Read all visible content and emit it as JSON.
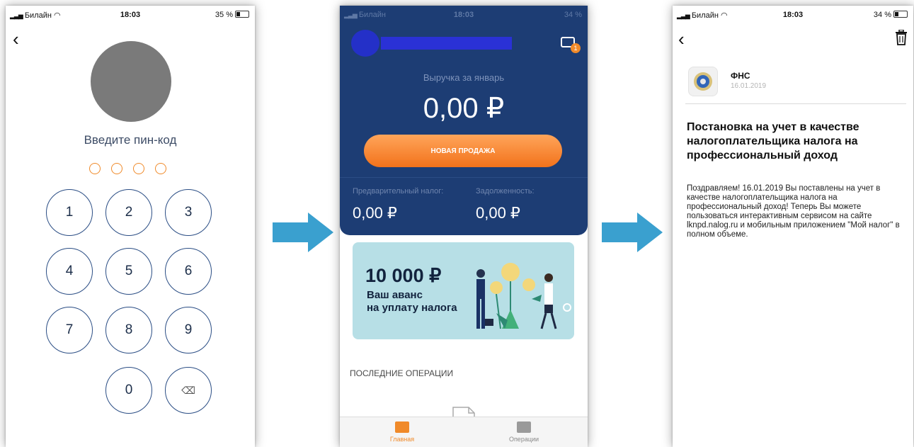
{
  "status_left": {
    "carrier": "Билайн",
    "time": "18:03",
    "battery": "35 %"
  },
  "status_mid": {
    "carrier": "Билайн",
    "time": "18:03",
    "battery": "34 %"
  },
  "status_right": {
    "carrier": "Билайн",
    "time": "18:03",
    "battery": "34 %"
  },
  "pin_screen": {
    "title": "Введите пин-код",
    "keys": [
      "1",
      "2",
      "3",
      "4",
      "5",
      "6",
      "7",
      "8",
      "9",
      "0"
    ],
    "delete_glyph": "⌫"
  },
  "dashboard": {
    "mail_badge": "1",
    "revenue_label": "Выручка за январь",
    "revenue_value": "0,00 ₽",
    "new_sale_label": "НОВАЯ ПРОДАЖА",
    "tax_label": "Предварительный налог:",
    "tax_value": "0,00 ₽",
    "debt_label": "Задолженность:",
    "debt_value": "0,00 ₽",
    "promo": {
      "amount": "10 000 ₽",
      "line1": "Ваш аванс",
      "line2": "на уплату налога"
    },
    "recent_title": "ПОСЛЕДНИЕ ОПЕРАЦИИ",
    "tabs": [
      "Главная",
      "Операции"
    ]
  },
  "message": {
    "sender": "ФНС",
    "date": "16.01.2019",
    "title": "Постановка на учет в качестве налогоплательщика налога на профессиональный доход",
    "body": "Поздравляем! 16.01.2019 Вы поставлены на учет в качестве налогоплательщика налога на профессиональный доход! Теперь Вы можете пользоваться интерактивным сервисом на сайте lknpd.nalog.ru и мобильным приложением \"Мой налог\" в полном объеме."
  },
  "colors": {
    "accent": "#f08a2a",
    "dashboard_bg": "#1d3d74",
    "arrow": "#3aa0cf"
  }
}
